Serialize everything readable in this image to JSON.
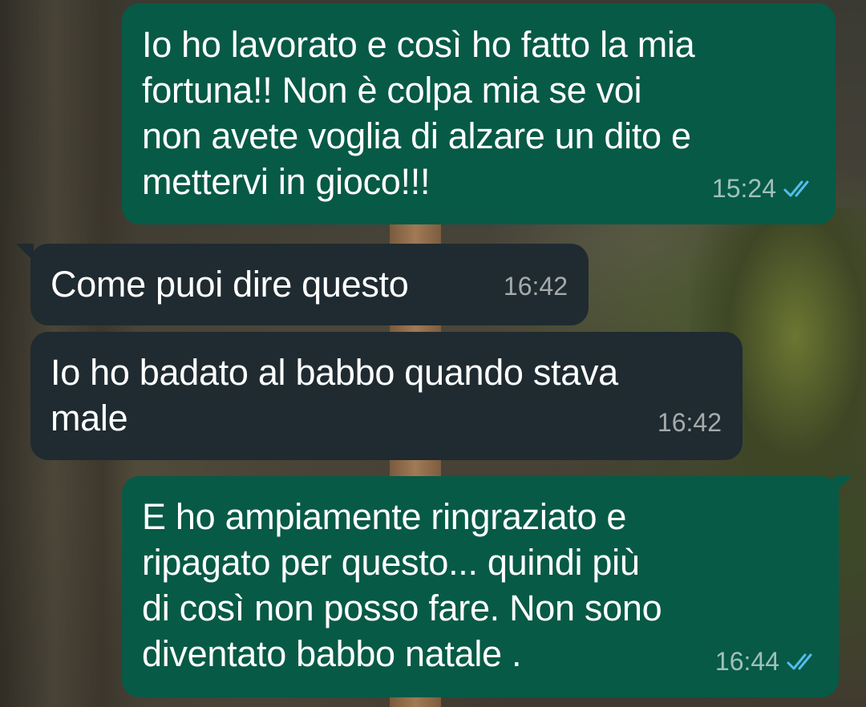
{
  "messages": [
    {
      "direction": "outgoing",
      "text": "Io ho lavorato e così ho fatto la mia\nfortuna!! Non è colpa mia se voi\nnon avete voglia di alzare un dito e\nmettervi in gioco!!!",
      "time": "15:24",
      "status": "read",
      "status_icon": "double-check-icon"
    },
    {
      "direction": "incoming",
      "text": "Come puoi dire questo",
      "time": "16:42"
    },
    {
      "direction": "incoming",
      "text": "Io ho badato al babbo quando stava\nmale",
      "time": "16:42"
    },
    {
      "direction": "outgoing",
      "text": "E ho ampiamente ringraziato e\nripagato per questo... quindi più\ndi così non posso fare. Non sono\ndiventato babbo natale .",
      "time": "16:44",
      "status": "read",
      "status_icon": "double-check-icon"
    }
  ],
  "colors": {
    "outgoing_bubble": "#075a46",
    "incoming_bubble": "#1f2b30",
    "read_ticks": "#53bdeb"
  }
}
